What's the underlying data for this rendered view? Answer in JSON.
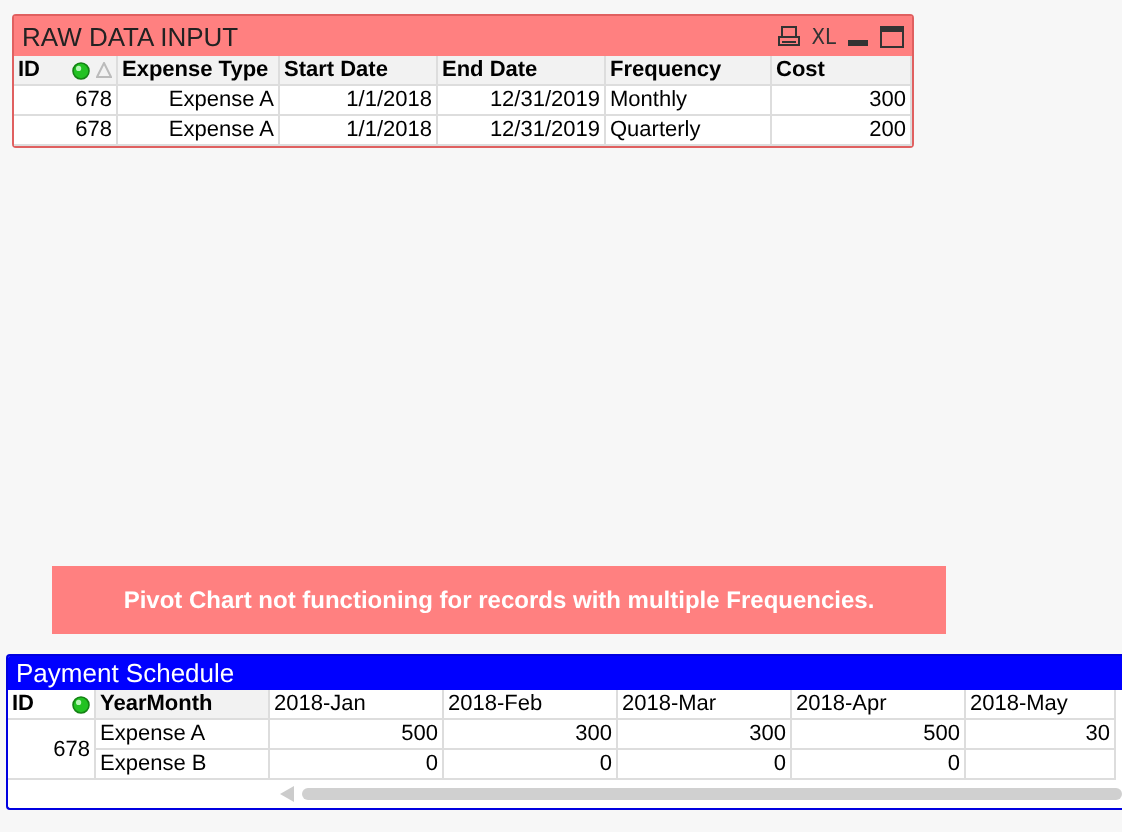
{
  "raw_data_input": {
    "title": "RAW DATA INPUT",
    "toolbar_text": "XL",
    "columns": [
      "ID",
      "Expense Type",
      "Start Date",
      "End Date",
      "Frequency",
      "Cost"
    ],
    "rows": [
      [
        "678",
        "Expense A",
        "1/1/2018",
        "12/31/2019",
        "Monthly",
        "300"
      ],
      [
        "678",
        "Expense A",
        "1/1/2018",
        "12/31/2019",
        "Quarterly",
        "200"
      ]
    ]
  },
  "banner": {
    "text": "Pivot Chart not functioning for records with multiple Frequencies."
  },
  "payment_schedule": {
    "title": "Payment Schedule",
    "columns": [
      "ID",
      "YearMonth",
      "2018-Jan",
      "2018-Feb",
      "2018-Mar",
      "2018-Apr",
      "2018-May"
    ],
    "id": "678",
    "rows": [
      {
        "label": "Expense A",
        "values": [
          "500",
          "300",
          "300",
          "500",
          "30"
        ]
      },
      {
        "label": "Expense B",
        "values": [
          "0",
          "0",
          "0",
          "0"
        ]
      }
    ]
  }
}
